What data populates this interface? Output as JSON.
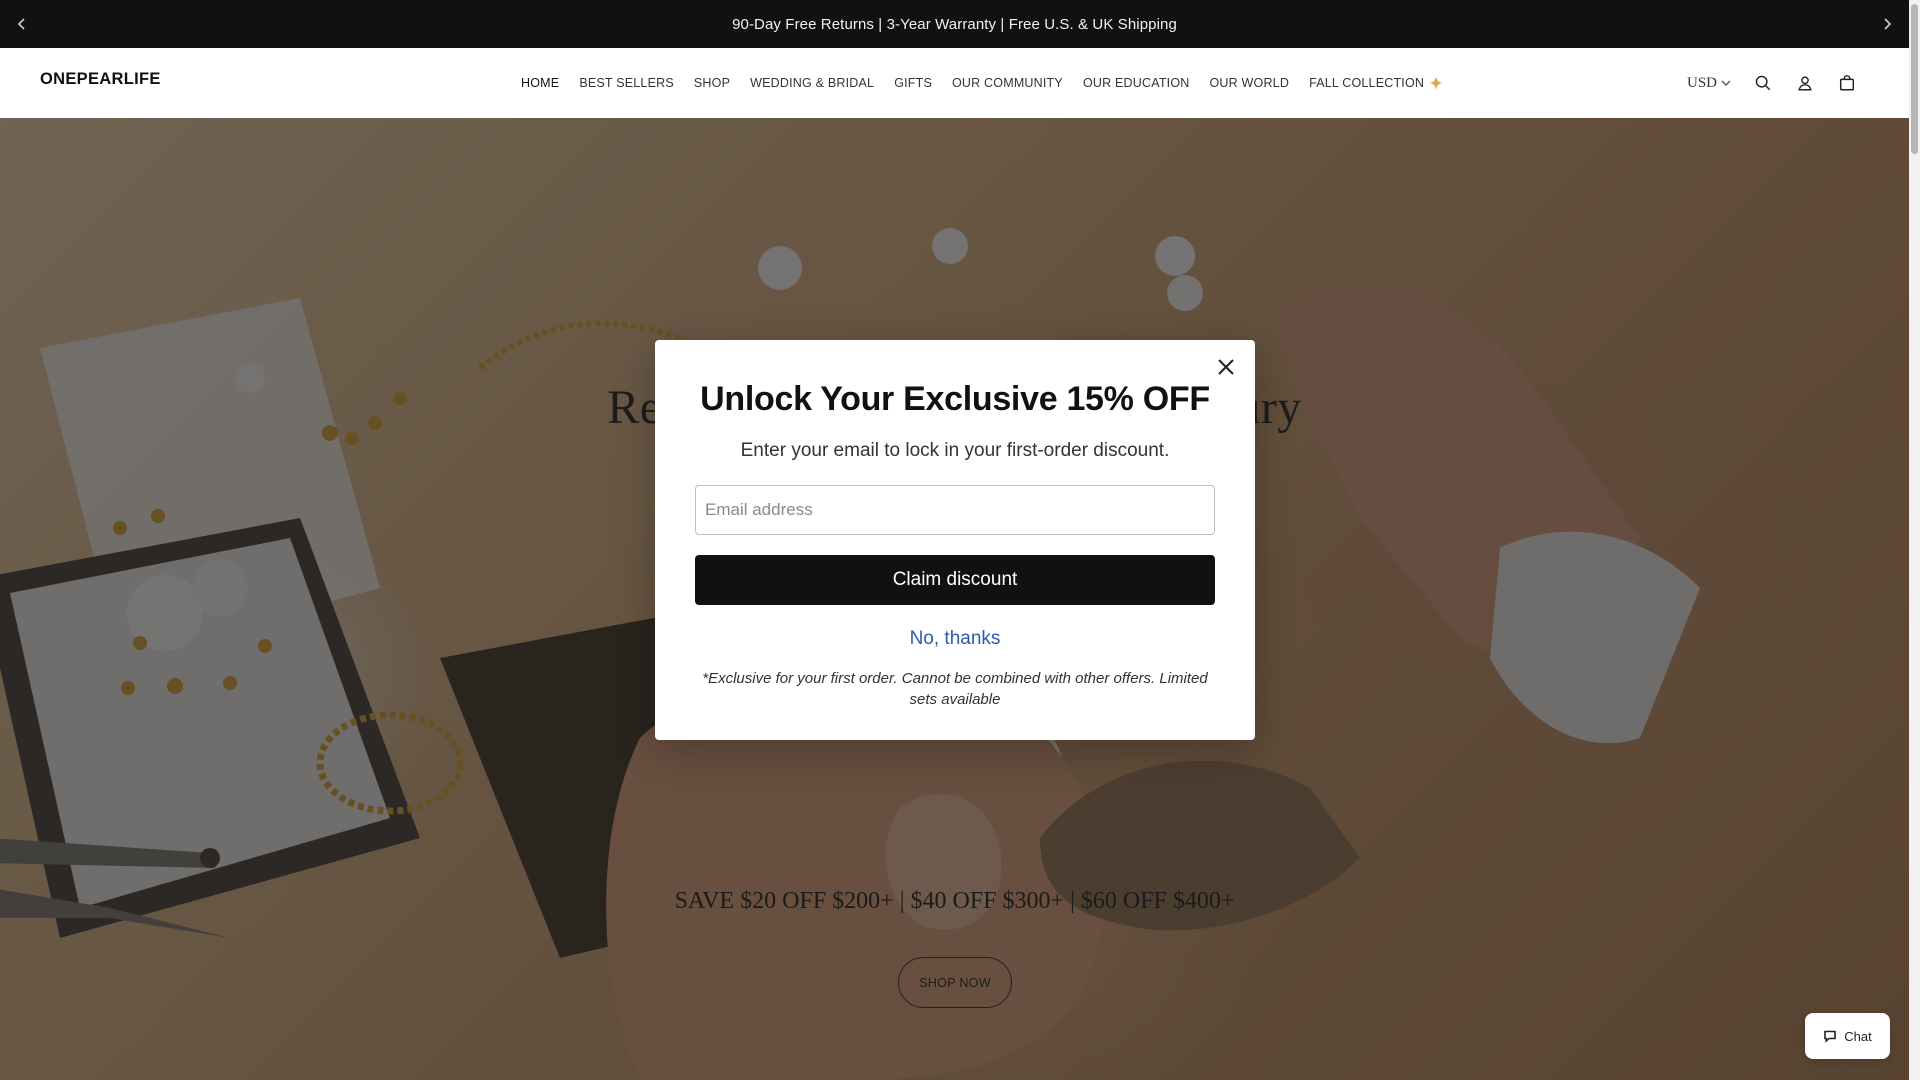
{
  "announcement": {
    "text": "90-Day Free Returns | 3-Year Warranty | Free U.S. & UK Shipping"
  },
  "header": {
    "logo": "ONEPEARLIFE",
    "nav": [
      {
        "label": "HOME",
        "active": true
      },
      {
        "label": "BEST SELLERS"
      },
      {
        "label": "SHOP"
      },
      {
        "label": "WEDDING & BRIDAL"
      },
      {
        "label": "GIFTS"
      },
      {
        "label": "OUR COMMUNITY"
      },
      {
        "label": "OUR EDUCATION"
      },
      {
        "label": "OUR WORLD"
      },
      {
        "label": "FALL COLLECTION",
        "icon": "sparkle-icon"
      }
    ],
    "currency": "USD",
    "icons": [
      "search-icon",
      "account-icon",
      "cart-icon"
    ]
  },
  "hero": {
    "title_left": "Refi",
    "title_right": "xury",
    "promo": "SAVE $20 OFF $200+ | $40 OFF $300+ | $60 OFF $400+",
    "cta": "SHOP NOW"
  },
  "modal": {
    "title": "Unlock Your Exclusive 15% OFF",
    "subtitle": "Enter your email to lock in your first-order discount.",
    "email_placeholder": "Email address",
    "email_value": "",
    "claim_label": "Claim discount",
    "decline_label": "No, thanks",
    "disclaimer": "*Exclusive for your first order. Cannot be combined with other offers. Limited sets available"
  },
  "chat": {
    "label": "Chat"
  },
  "colors": {
    "announcement_bg": "#111111",
    "claim_button_bg": "#111111",
    "decline_link": "#2f5aa8",
    "sparkle": "#d6ad4a"
  }
}
